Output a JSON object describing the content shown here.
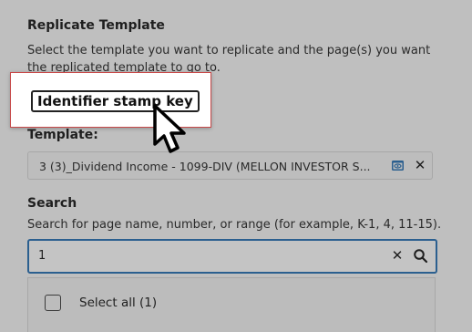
{
  "dialog": {
    "title": "Replicate Template",
    "description_line1": "Select the template you want to replicate and the page(s) you want",
    "description_line2": "the replicated template to go to."
  },
  "template": {
    "label": "Template:",
    "value": "3 (3)_Dividend Income - 1099-DIV (MELLON INVESTOR S...",
    "icons": [
      "preview-icon",
      "close-icon"
    ],
    "clear_glyph": "✕"
  },
  "search": {
    "label": "Search",
    "hint": "Search for page name, number, or range (for example, K-1, 4, 11-15).",
    "value": "1",
    "clear_glyph": "✕",
    "icons": [
      "close-icon",
      "search-icon"
    ]
  },
  "results": {
    "select_all_label": "Select all (1)",
    "select_all_checked": false
  },
  "tooltip": {
    "text": "Identifier stamp key"
  },
  "colors": {
    "overlay_gray": "#bfbfbf",
    "focus_border": "#2b5f8f",
    "tooltip_border": "#c74a4a",
    "preview_icon": "#2b5f8f"
  }
}
